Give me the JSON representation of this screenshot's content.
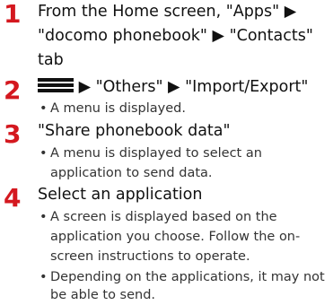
{
  "steps": [
    {
      "number": "1",
      "lines": [
        "From the Home screen, \"Apps\" ▶",
        "\"docomo phonebook\" ▶ \"Contacts\"",
        "tab"
      ]
    },
    {
      "number": "2",
      "icon": "menu-icon",
      "title_after_icon": " ▶ \"Others\" ▶ \"Import/Export\"",
      "bullets": [
        [
          "A menu is displayed."
        ]
      ]
    },
    {
      "number": "3",
      "title": "\"Share phonebook data\"",
      "bullets": [
        [
          "A menu is displayed to select an",
          "application to send data."
        ]
      ]
    },
    {
      "number": "4",
      "title": "Select an application",
      "bullets": [
        [
          "A screen is displayed based on the",
          "application you choose. Follow the on-",
          "screen instructions to operate."
        ],
        [
          "Depending on the applications, it may not",
          "be able to send."
        ]
      ]
    }
  ],
  "bullet_char": "•",
  "colors": {
    "step_number": "#d4181f",
    "text": "#222222"
  }
}
